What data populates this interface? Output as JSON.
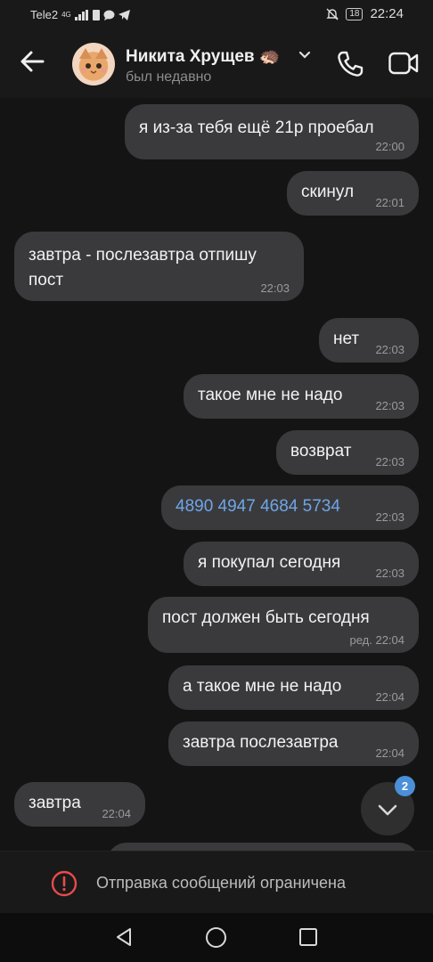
{
  "status_bar": {
    "carrier": "Tele2",
    "network": "4G",
    "battery": "18",
    "time": "22:24"
  },
  "header": {
    "contact_name": "Никита Хрущев",
    "emoji": "🦔",
    "last_seen": "был недавно"
  },
  "messages": [
    {
      "text": "я из-за тебя ещё 21р проебал",
      "time": "22:00",
      "outgoing": true
    },
    {
      "text": "скинул",
      "time": "22:01",
      "outgoing": true
    },
    {
      "text": "завтра - послезавтра отпишу пост",
      "time": "22:03",
      "outgoing": false
    },
    {
      "text": "нет",
      "time": "22:03",
      "outgoing": true
    },
    {
      "text": "такое мне не надо",
      "time": "22:03",
      "outgoing": true
    },
    {
      "text": "возврат",
      "time": "22:03",
      "outgoing": true
    },
    {
      "text": "4890 4947 4684 5734",
      "time": "22:03",
      "outgoing": true,
      "link": true
    },
    {
      "text": "я покупал сегодня",
      "time": "22:03",
      "outgoing": true
    },
    {
      "text": "пост должен быть сегодня",
      "time": "ред. 22:04",
      "outgoing": true
    },
    {
      "text": "а такое мне не надо",
      "time": "22:04",
      "outgoing": true
    },
    {
      "text": "завтра послезавтра",
      "time": "22:04",
      "outgoing": true
    },
    {
      "text": "завтра",
      "time": "22:04",
      "outgoing": false
    }
  ],
  "scroll_down": {
    "unread_count": "2"
  },
  "restriction": {
    "text": "Отправка сообщений ограничена"
  },
  "colors": {
    "bubble": "#3a3a3c",
    "link": "#6ea6e8",
    "badge": "#4b8fd8",
    "warning": "#e84b4b"
  }
}
